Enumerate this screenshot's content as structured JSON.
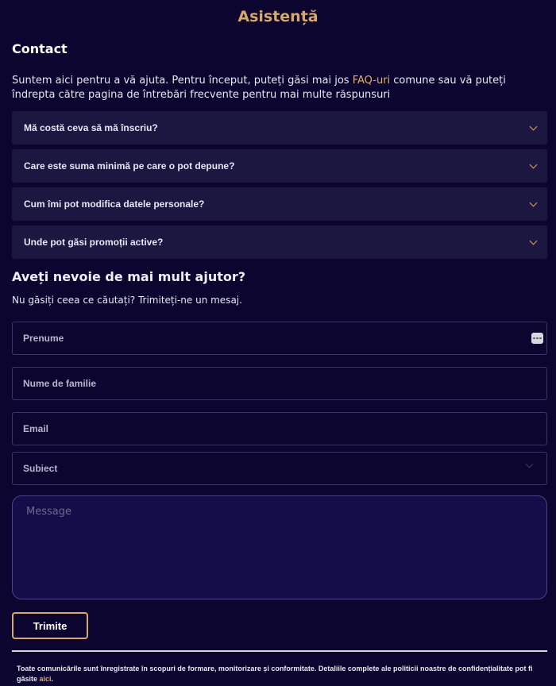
{
  "header": {
    "title": "Asistență"
  },
  "contact": {
    "title": "Contact",
    "intro_before": "Suntem aici pentru a vă ajuta. Pentru început, puteți găsi mai jos ",
    "intro_link": "FAQ-uri",
    "intro_after": " comune sau vă puteți îndrepta către pagina de întrebări frecvente pentru mai multe răspunsuri"
  },
  "faq": [
    {
      "question": "Mă costă ceva să mă înscriu?"
    },
    {
      "question": "Care este suma minimă pe care o pot depune?"
    },
    {
      "question": "Cum îmi pot modifica datele personale?"
    },
    {
      "question": "Unde pot găsi promoții active?"
    }
  ],
  "help": {
    "title": "Aveți nevoie de mai mult ajutor?",
    "subtitle": "Nu găsiți ceea ce căutați? Trimiteți-ne un mesaj."
  },
  "form": {
    "first_name_placeholder": "Prenume",
    "last_name_placeholder": "Nume de familie",
    "email_placeholder": "Email",
    "subject_label": "Subiect",
    "message_placeholder": "Message",
    "submit_label": "Trimite"
  },
  "footer": {
    "text_before": "Toate comunicările sunt înregistrate în scopuri de formare, monitorizare și conformitate. Detaliile complete ale politicii noastre de confidențialitate pot fi găsite ",
    "link": "aici",
    "text_after": "."
  },
  "icons": {
    "faq_chevron": "chevron-down-icon",
    "autofill": "dots-icon",
    "select_chevron": "chevron-down-icon"
  },
  "colors": {
    "background": "#0b0530",
    "accent": "#d7a868",
    "card": "#1b1740",
    "message_bg": "#130e4a"
  }
}
